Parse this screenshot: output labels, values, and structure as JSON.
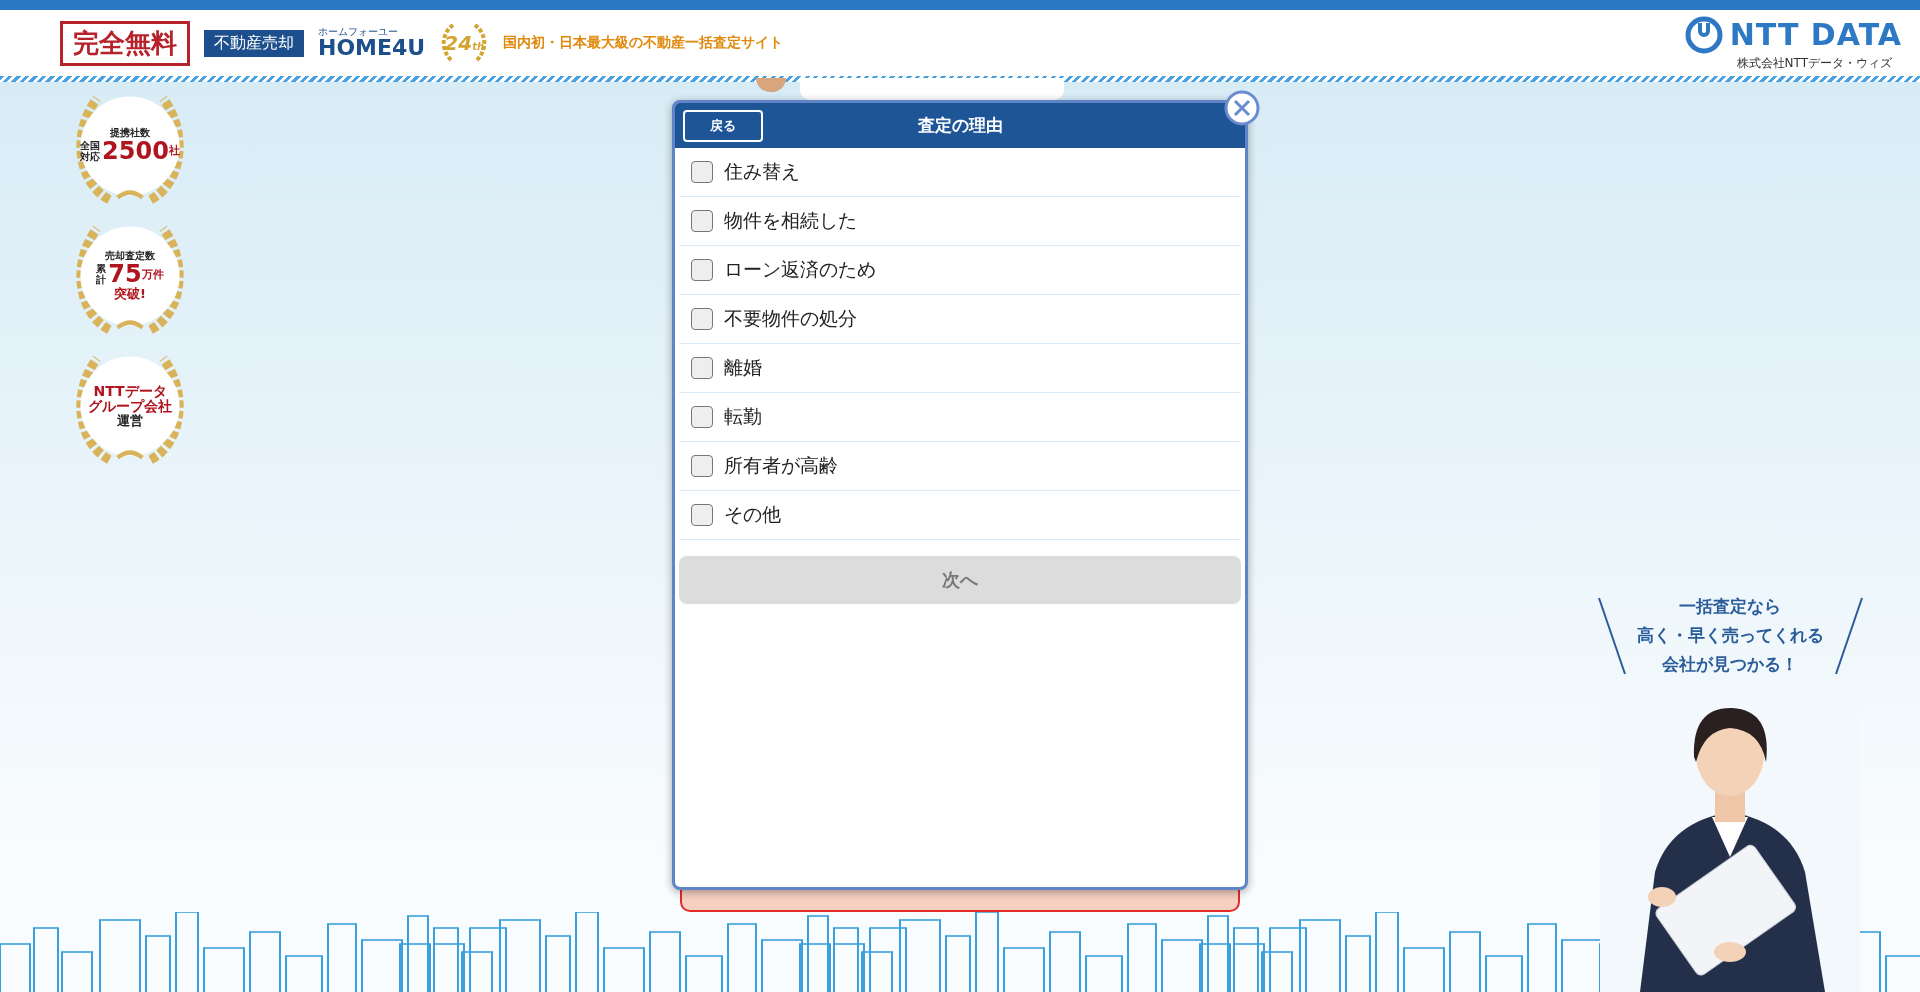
{
  "header": {
    "free_badge": "完全無料",
    "category_tag": "不動産売却",
    "brand_kana": "ホームフォーユー",
    "brand": "HOME4U",
    "anniversary": "24",
    "anniversary_suffix": "th",
    "tagline": "国内初・日本最大級の不動産一括査定サイト",
    "corp_logo": "NTT DATA",
    "corp_name": "株式会社NTTデータ・ウィズ"
  },
  "badges": [
    {
      "kind": "stat",
      "caption": "提携社数",
      "side": "全国対応",
      "figure": "2500",
      "unit": "社"
    },
    {
      "kind": "stat",
      "caption": "売却査定数",
      "side": "累計",
      "figure": "75",
      "unit": "万件",
      "footer": "突破!"
    },
    {
      "kind": "text",
      "lines": [
        "NTTデータ",
        "グループ会社"
      ],
      "footer": "運営"
    }
  ],
  "modal": {
    "back": "戻る",
    "title": "査定の理由",
    "options": [
      {
        "label": "住み替え",
        "checked": false
      },
      {
        "label": "物件を相続した",
        "checked": false
      },
      {
        "label": "ローン返済のため",
        "checked": false
      },
      {
        "label": "不要物件の処分",
        "checked": false
      },
      {
        "label": "離婚",
        "checked": false
      },
      {
        "label": "転勤",
        "checked": false
      },
      {
        "label": "所有者が高齢",
        "checked": false
      },
      {
        "label": "その他",
        "checked": false
      }
    ],
    "next": {
      "label": "次へ",
      "disabled": true
    }
  },
  "ad": {
    "lines": [
      "一括査定なら",
      "高く・早く売ってくれる",
      "会社が見つかる！"
    ]
  }
}
